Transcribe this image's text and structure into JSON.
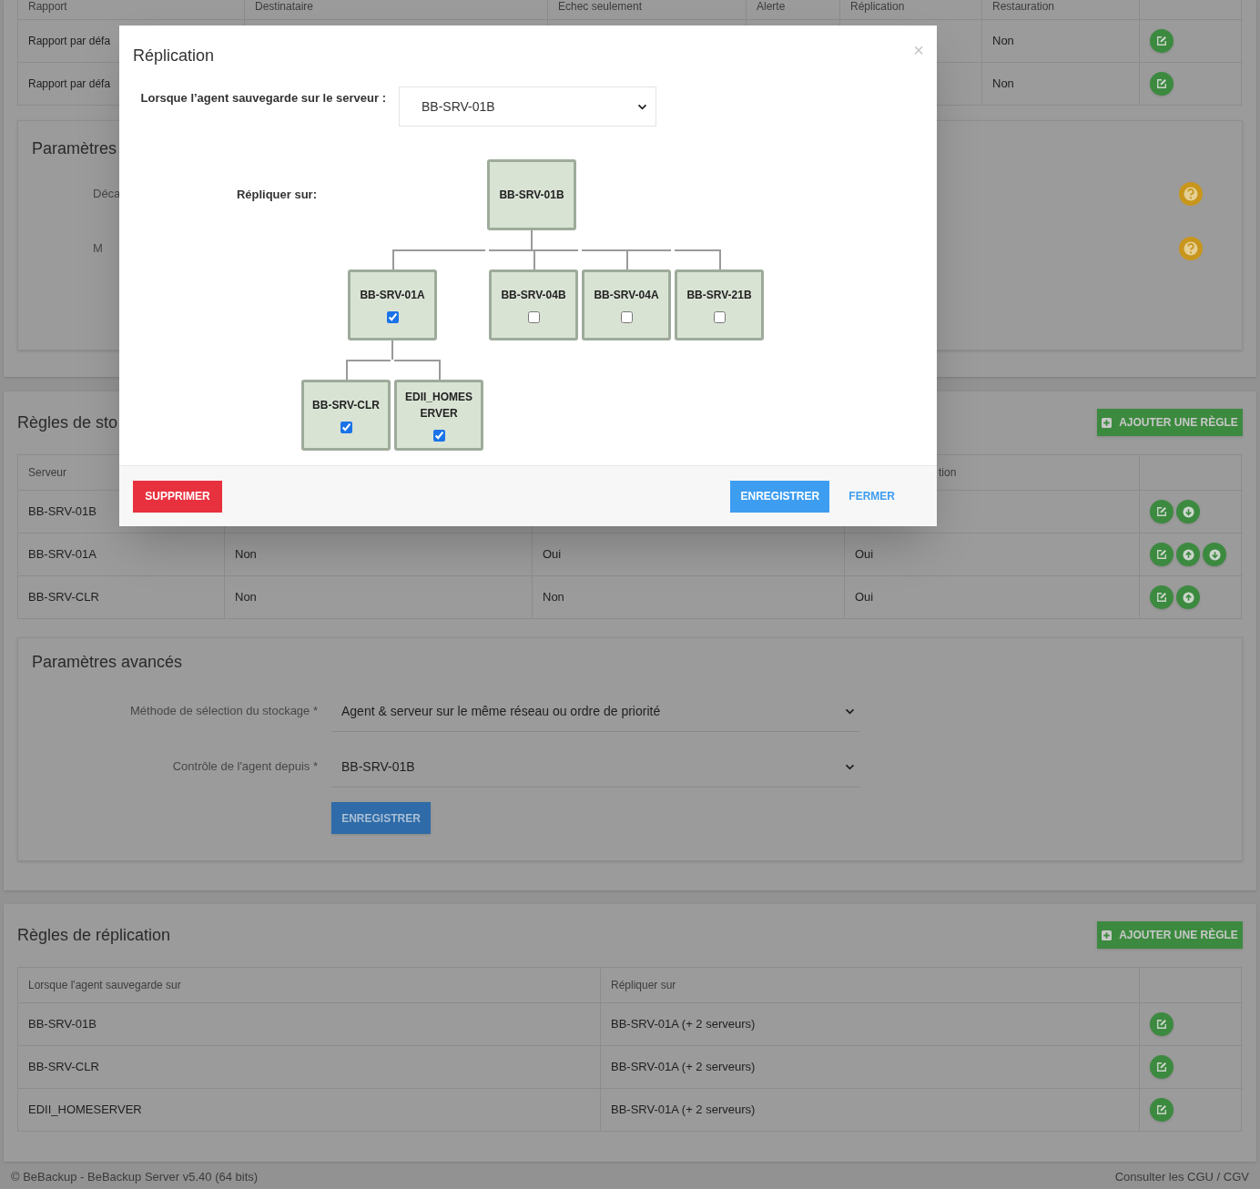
{
  "reports_table": {
    "columns": [
      "Rapport",
      "Destinataire",
      "Echec seulement",
      "Alerte",
      "Réplication",
      "Restauration"
    ],
    "rows": [
      {
        "report": "Rapport par défa",
        "restoration": "Non",
        "actions": [
          {
            "kind": "edit"
          }
        ]
      },
      {
        "report": "Rapport par défa",
        "restoration": "Non",
        "actions": [
          {
            "kind": "edit"
          }
        ]
      }
    ]
  },
  "settings_card": {
    "title": "Paramètres",
    "fields": [
      {
        "label": "Déca"
      },
      {
        "label": "M"
      }
    ]
  },
  "storage_rules": {
    "title": "Règles de sto",
    "add_button": "AJOUTER UNE RÈGLE",
    "header": {
      "server": "Serveur",
      "column_4": "tion"
    },
    "rows": [
      {
        "server": "BB-SRV-01B",
        "actions": [
          {
            "kind": "edit"
          },
          {
            "kind": "down"
          }
        ]
      },
      {
        "server": "BB-SRV-01A",
        "cells": [
          "Non",
          "Oui",
          "Oui"
        ],
        "actions": [
          {
            "kind": "edit"
          },
          {
            "kind": "up"
          },
          {
            "kind": "down"
          }
        ]
      },
      {
        "server": "BB-SRV-CLR",
        "cells": [
          "Non",
          "Non",
          "Oui"
        ],
        "actions": [
          {
            "kind": "edit"
          },
          {
            "kind": "up"
          }
        ]
      }
    ]
  },
  "advanced_settings": {
    "title": "Paramètres avancés",
    "fields": [
      {
        "label": "Méthode de sélection du stockage *",
        "value": "Agent & serveur sur le même réseau ou ordre de priorité"
      },
      {
        "label": "Contrôle de l'agent depuis *",
        "value": "BB-SRV-01B"
      }
    ],
    "save_button": "ENREGISTRER"
  },
  "replication_rules": {
    "title": "Règles de réplication",
    "add_button": "AJOUTER UNE RÈGLE",
    "columns": [
      "Lorsque l'agent sauvegarde sur",
      "Répliquer sur"
    ],
    "rows": [
      {
        "source": "BB-SRV-01B",
        "target": "BB-SRV-01A (+ 2 serveurs)",
        "actions": [
          {
            "kind": "edit"
          }
        ]
      },
      {
        "source": "BB-SRV-CLR",
        "target": "BB-SRV-01A (+ 2 serveurs)",
        "actions": [
          {
            "kind": "edit"
          }
        ]
      },
      {
        "source": "EDII_HOMESERVER",
        "target": "BB-SRV-01A (+ 2 serveurs)",
        "actions": [
          {
            "kind": "edit"
          }
        ]
      }
    ]
  },
  "footer": {
    "copyright": "© BeBackup - BeBackup Server v5.40 (64 bits)",
    "terms_link": "Consulter les CGU / CGV"
  },
  "modal": {
    "title": "Réplication",
    "close": "×",
    "source_label": "Lorsque l’agent sauvegarde sur le serveur :",
    "source_value": "BB-SRV-01B",
    "target_label": "Répliquer sur:",
    "tree": {
      "label": "BB-SRV-01B",
      "children": [
        {
          "label": "BB-SRV-01A",
          "checked": true,
          "children": [
            {
              "label": "BB-SRV-CLR",
              "checked": true
            },
            {
              "label": "EDII_HOMESERVER",
              "checked": true
            }
          ]
        },
        {
          "label": "BB-SRV-04B",
          "checked": false
        },
        {
          "label": "BB-SRV-04A",
          "checked": false
        },
        {
          "label": "BB-SRV-21B",
          "checked": false
        }
      ]
    },
    "delete_button": "SUPPRIMER",
    "save_button": "ENREGISTRER",
    "close_button": "FERMER"
  }
}
